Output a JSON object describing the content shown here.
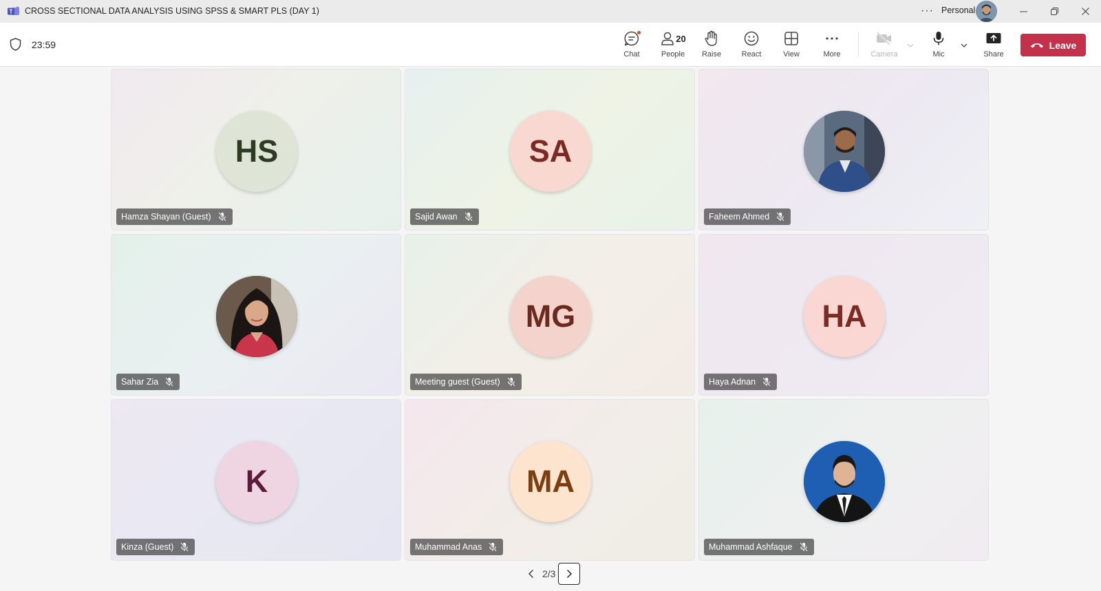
{
  "window": {
    "title": "CROSS SECTIONAL DATA ANALYSIS USING SPSS & SMART PLS (DAY 1)",
    "more": "···",
    "account": "Personal"
  },
  "meeting": {
    "timer": "23:59",
    "toolbar": {
      "chat": "Chat",
      "people": "People",
      "people_count": "20",
      "raise": "Raise",
      "react": "React",
      "view": "View",
      "more": "More",
      "camera": "Camera",
      "mic": "Mic",
      "share": "Share",
      "leave": "Leave"
    }
  },
  "colors": {
    "leave": "#c4314b",
    "chat_badge": "#d74a27"
  },
  "participants": [
    {
      "name": "Hamza Shayan (Guest)",
      "initials": "HS",
      "avatar_bg": "#dfe5d6",
      "avatar_fg": "#2f3a23",
      "photo": false,
      "bg": "linear-gradient(135deg,#f1e9ef 0%,#eff0ea 45%,#e6f1ec 100%)"
    },
    {
      "name": "Sajid Awan",
      "initials": "SA",
      "avatar_bg": "#f9d8d2",
      "avatar_fg": "#7a2a22",
      "photo": false,
      "bg": "linear-gradient(135deg,#e6f0ef 0%,#eef3e5 50%,#e9f2e8 100%)"
    },
    {
      "name": "Faheem Ahmed",
      "initials": "",
      "avatar_bg": "#5a6b80",
      "avatar_fg": "#ffffff",
      "photo": "man-sweater",
      "bg": "linear-gradient(135deg,#f2e8ee 0%,#ede9f2 55%,#eef0f4 100%)"
    },
    {
      "name": "Sahar Zia",
      "initials": "",
      "avatar_bg": "#4a3a32",
      "avatar_fg": "#ffffff",
      "photo": "woman",
      "bg": "linear-gradient(135deg,#e3f1ea 0%,#eaf0f1 50%,#eae8f3 100%)"
    },
    {
      "name": "Meeting guest (Guest)",
      "initials": "MG",
      "avatar_bg": "#f3d3cc",
      "avatar_fg": "#6b2a20",
      "photo": false,
      "bg": "linear-gradient(135deg,#e7f0ea 0%,#f3efe8 50%,#f3ebe6 100%)"
    },
    {
      "name": "Haya Adnan",
      "initials": "HA",
      "avatar_bg": "#fad7d3",
      "avatar_fg": "#7c2a24",
      "photo": false,
      "bg": "linear-gradient(135deg,#f1e7ef 0%,#efe9f2 55%,#f0ecf3 100%)"
    },
    {
      "name": "Kinza (Guest)",
      "initials": "K",
      "avatar_bg": "#efd4e2",
      "avatar_fg": "#5a1a3a",
      "photo": false,
      "bg": "linear-gradient(135deg,#ede8f2 0%,#e8e8f3 55%,#e6e6f2 100%)"
    },
    {
      "name": "Muhammad Anas",
      "initials": "MA",
      "avatar_bg": "#fce4cf",
      "avatar_fg": "#7a3e12",
      "photo": false,
      "bg": "linear-gradient(135deg,#f4e7ee 0%,#f2ede8 55%,#efede6 100%)"
    },
    {
      "name": "Muhammad Ashfaque",
      "initials": "",
      "avatar_bg": "#1f5fb3",
      "avatar_fg": "#ffffff",
      "photo": "man-suit",
      "bg": "linear-gradient(135deg,#e6f1ec 0%,#eef0ef 50%,#f1ecf1 100%)"
    }
  ],
  "pager": {
    "text": "2/3"
  }
}
